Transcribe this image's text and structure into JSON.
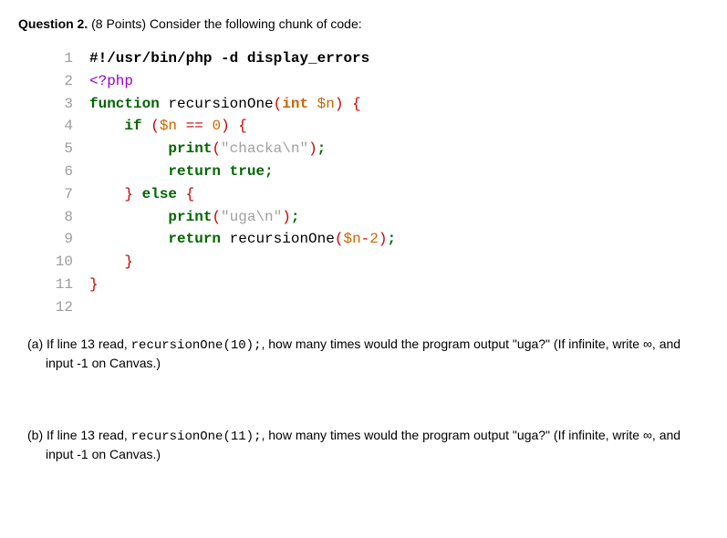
{
  "question": {
    "label_bold": "Question 2.",
    "points": "(8 Points) ",
    "intro": "Consider the following chunk of code:"
  },
  "code": {
    "lines": [
      {
        "n": "1",
        "html": "<span class='shebang'>#!/usr/bin/php -d display_errors</span>"
      },
      {
        "n": "2",
        "html": "<span class='pr'>&lt;?php</span>"
      },
      {
        "n": "3",
        "html": "<span class='k'>function</span> <span class='fn'>recursionOne</span><span class='br'>(</span><span class='ty'>int</span> <span class='v'>$n</span><span class='br'>)</span> <span class='br'>{</span>"
      },
      {
        "n": "4",
        "html": "    <span class='k'>if</span> <span class='br'>(</span><span class='v'>$n</span> <span class='op'>==</span> <span class='n'>0</span><span class='br'>)</span> <span class='br'>{</span>"
      },
      {
        "n": "5",
        "html": "         <span class='k'>print</span><span class='br'>(</span><span class='s'>\"chacka\\n\"</span><span class='br'>)</span><span class='sc'>;</span>"
      },
      {
        "n": "6",
        "html": "         <span class='k'>return</span> <span class='k'>true</span><span class='sc'>;</span>"
      },
      {
        "n": "7",
        "html": "    <span class='br'>}</span> <span class='k'>else</span> <span class='br'>{</span>"
      },
      {
        "n": "8",
        "html": "         <span class='k'>print</span><span class='br'>(</span><span class='s'>\"uga\\n\"</span><span class='br'>)</span><span class='sc'>;</span>"
      },
      {
        "n": "9",
        "html": "         <span class='k'>return</span> <span class='fn'>recursionOne</span><span class='br'>(</span><span class='v'>$n</span><span class='op'>-</span><span class='n'>2</span><span class='br'>)</span><span class='sc'>;</span>"
      },
      {
        "n": "10",
        "html": "    <span class='br'>}</span>"
      },
      {
        "n": "11",
        "html": "<span class='br'>}</span>"
      },
      {
        "n": "12",
        "html": " "
      }
    ]
  },
  "parts": {
    "a": {
      "label": "(a)",
      "pre": "If line 13 read, ",
      "code": "recursionOne(10);",
      "post": ", how many times would the program output \"uga?\" (If infinite, write ∞, and input -1 on Canvas.)"
    },
    "b": {
      "label": "(b)",
      "pre": "If line 13 read, ",
      "code": "recursionOne(11);",
      "post": ", how many times would the program output \"uga?\" (If infinite, write ∞, and input -1 on Canvas.)"
    }
  }
}
